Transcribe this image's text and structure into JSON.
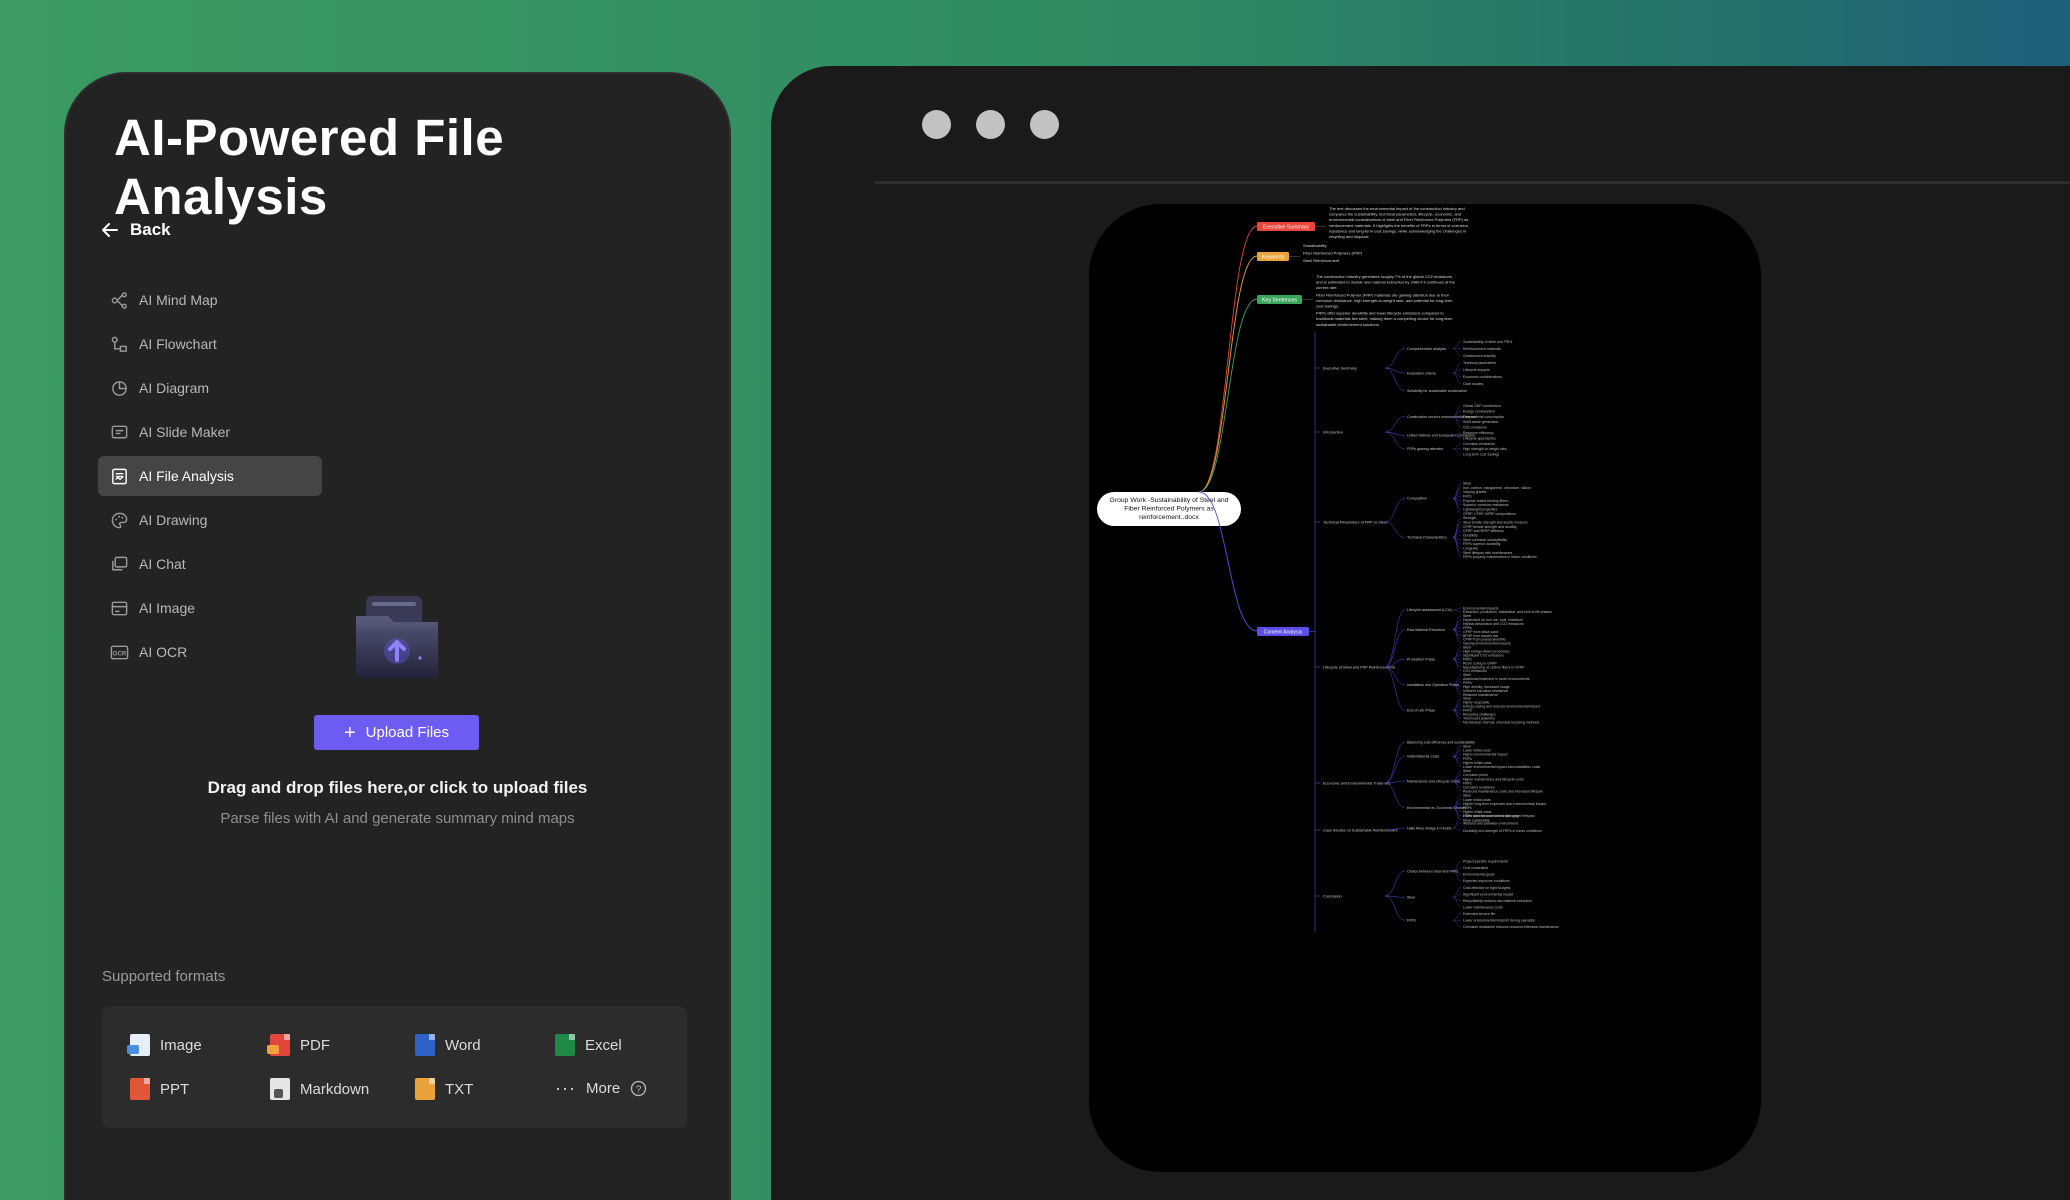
{
  "panel": {
    "title": "AI-Powered File Analysis",
    "back_label": "Back",
    "menu": [
      {
        "label": "AI Mind Map",
        "icon": "mind-map-icon",
        "active": false
      },
      {
        "label": "AI Flowchart",
        "icon": "flowchart-icon",
        "active": false
      },
      {
        "label": "AI Diagram",
        "icon": "diagram-icon",
        "active": false
      },
      {
        "label": "AI Slide Maker",
        "icon": "slide-icon",
        "active": false
      },
      {
        "label": "AI File Analysis",
        "icon": "file-analysis-icon",
        "active": true
      },
      {
        "label": "AI Drawing",
        "icon": "palette-icon",
        "active": false
      },
      {
        "label": "AI Chat",
        "icon": "chat-icon",
        "active": false
      },
      {
        "label": "AI Image",
        "icon": "image-icon",
        "active": false
      },
      {
        "label": "AI OCR",
        "icon": "ocr-icon",
        "active": false
      }
    ],
    "upload": {
      "button_label": "Upload Files",
      "drop_title": "Drag and drop files here,or click to upload files",
      "drop_subtitle": "Parse files with AI and generate summary mind maps"
    },
    "formats_label": "Supported formats",
    "formats": [
      {
        "label": "Image",
        "icon": "image-file-icon",
        "color": "#4a8fe0"
      },
      {
        "label": "PDF",
        "icon": "pdf-file-icon",
        "color": "#e2463a"
      },
      {
        "label": "Word",
        "icon": "word-file-icon",
        "color": "#2f62c8"
      },
      {
        "label": "Excel",
        "icon": "excel-file-icon",
        "color": "#1f8a47"
      },
      {
        "label": "PPT",
        "icon": "ppt-file-icon",
        "color": "#e2563a"
      },
      {
        "label": "Markdown",
        "icon": "markdown-file-icon",
        "color": "#e6e6e6"
      },
      {
        "label": "TXT",
        "icon": "txt-file-icon",
        "color": "#e9a33a"
      },
      {
        "label": "More",
        "icon": "more-icon",
        "color": "#dcdcdc"
      }
    ],
    "accent_color": "#6c5cf2"
  },
  "mindmap": {
    "root": "Group Work -Sustainability of Steel and Fiber Reinforced Polymers as reinforcement..docx",
    "root_lines": [
      "Group Work -Sustainability of Steel and",
      "Fiber Reinforced Polymers as",
      "reinforcement..docx"
    ],
    "branches": [
      {
        "label": "Executive Summary",
        "color": "#e8453c",
        "notes": [
          "The text discusses the environmental impact of the construction industry and",
          "compares the sustainability, technical parameters, lifecycle, economic, and",
          "environmental considerations of steel and Fiber Reinforced Polymers (FRP) as",
          "reinforcement materials. It highlights the benefits of FRPs in terms of corrosion",
          "resistance and long-term cost savings, while acknowledging the challenges in",
          "recycling and disposal."
        ]
      },
      {
        "label": "Keywords",
        "color": "#e8a33a",
        "notes": [
          "Sustainability",
          "Fiber Reinforced Polymers (FRP)",
          "Steel Reinforcement"
        ]
      },
      {
        "label": "Key Sentences",
        "color": "#3aa65a",
        "notes": [
          "The construction industry generates roughly 7% of the global CO2 emissions",
          "and is estimated to double raw material extraction by 2060 if it continues at the",
          "current rate.",
          "Fiber Reinforced Polymer (FRP) materials are gaining attention due to their",
          "corrosion resistance, high strength-to-weight ratio, and potential for long-term",
          "cost savings.",
          "FRPs offer superior durability and lower lifecycle emissions compared to",
          "traditional materials like steel, making them a compelling choice for long-term",
          "sustainable reinforcement solutions."
        ]
      },
      {
        "label": "Content Analysis",
        "color": "#5a4ee6",
        "notes": []
      }
    ],
    "content_sections": [
      {
        "label": "Executive Summary",
        "children": [
          {
            "label": "Comprehensive analysis",
            "leaves": [
              "Sustainability of steel and FRPs",
              "Reinforcement materials",
              "Construction industry"
            ]
          },
          {
            "label": "Evaluation criteria",
            "leaves": [
              "Technical parameters",
              "Lifecycle impacts",
              "Economic considerations",
              "Case studies"
            ]
          },
          {
            "label": "Suitability for sustainable construction",
            "leaves": []
          }
        ]
      },
      {
        "label": "Introduction",
        "children": [
          {
            "label": "Construction sector's environmental impact",
            "leaves": [
              "Global GDP contribution",
              "Energy consumption",
              "Raw material consumption",
              "Solid waste generation",
              "CO2 emissions"
            ]
          },
          {
            "label": "United Nations and European Commission",
            "leaves": [
              "Resource efficiency",
              "Lifecycle approaches"
            ]
          },
          {
            "label": "FRPs gaining attention",
            "leaves": [
              "Corrosion resistance",
              "High strength-to-weight ratio",
              "Long-term cost savings"
            ]
          }
        ]
      },
      {
        "label": "Technical Parameters of FRP vs Steel",
        "children": [
          {
            "label": "Composition",
            "leaves": [
              "Steel",
              "Iron, carbon, manganese, chromium, silicon",
              "Varying grades",
              "FRPs",
              "Polymer matrix binding fibers",
              "Superior corrosion resistance",
              "Lightweight properties",
              "GFRP, CFRP, BFRP compositions"
            ]
          },
          {
            "label": "Technical Characteristics",
            "leaves": [
              "Strength",
              "Steel tensile strength and elastic modulus",
              "CFRP tensile strength and ductility",
              "GFRP and BFRP stiffness",
              "Durability",
              "Steel corrosion susceptibility",
              "FRPs superior durability",
              "Longevity",
              "Steel lifespan with maintenance",
              "FRPs property maintenance in harsh conditions"
            ]
          }
        ]
      },
      {
        "label": "Lifecycle of Steel and FRP Reinforcements",
        "children": [
          {
            "label": "Lifecycle assessment (LCA)",
            "leaves": [
              "Environmental impacts",
              "Extraction, production, installation, and end-of-life phases"
            ]
          },
          {
            "label": "Raw Material Extraction",
            "leaves": [
              "Steel",
              "Dependent on iron ore, coal, limestone",
              "Habitat destruction and CO2 emissions",
              "FRPs",
              "GFRP from silica sand",
              "BFRP from basalt rock",
              "CFRP from polyacrylonitrile",
              "Varying environmental impacts"
            ]
          },
          {
            "label": "Production Phase",
            "leaves": [
              "Steel",
              "High energy-driven processes",
              "Significant CO2 emissions",
              "FRPs",
              "Resin curing in GFRP",
              "Manufacturing of carbon fibers in CFRP",
              "CO2 emissions"
            ]
          },
          {
            "label": "Installation and Operation Phase",
            "leaves": [
              "Steel",
              "Additional treatment in harsh environments",
              "FRPs",
              "High density, increased usage",
              "Inherent corrosion resistance",
              "Reduced maintenance"
            ]
          },
          {
            "label": "End of Life Phase",
            "leaves": [
              "Steel",
              "Highly recyclable",
              "Energy saving and reduced environmental impact",
              "FRPs",
              "Recycling challenges",
              "Thermoset polymers",
              "Mechanical, thermal, chemical recycling methods"
            ]
          }
        ]
      },
      {
        "label": "Economic and Environmental Trade-offs",
        "children": [
          {
            "label": "Balancing cost efficiency and sustainability",
            "leaves": []
          },
          {
            "label": "Initial Material Costs",
            "leaves": [
              "Steel",
              "Lower initial costs",
              "Higher environmental impact",
              "FRPs",
              "Higher initial costs",
              "Lower environmental impact and installation costs"
            ]
          },
          {
            "label": "Maintenance and Lifecycle Costs",
            "leaves": [
              "Steel",
              "Corrosion prone",
              "Higher maintenance and lifecycle costs",
              "FRPs",
              "Corrosion resistance",
              "Reduced maintenance costs and increased lifespan"
            ]
          },
          {
            "label": "Environmental vs. Economic Choices",
            "leaves": [
              "Steel",
              "Lower initial costs",
              "Higher long-term expenses and environmental impact",
              "FRPs",
              "Higher initial costs",
              "Lower maintenance needs and longer lifespan",
              "More sustainable"
            ]
          }
        ]
      },
      {
        "label": "Case Studies on Sustainable Reinforcement",
        "children": [
          {
            "label": "Halls River Bridge in Florida",
            "leaves": [
              "FRPs used for corrosion challenges",
              "Wetland and saltwater environment",
              "Durability and strength of FRPs in harsh conditions"
            ]
          }
        ]
      },
      {
        "label": "Conclusion",
        "children": [
          {
            "label": "Choice between steel and FRPs",
            "leaves": [
              "Project-specific requirements",
              "Cost constraints",
              "Environmental goals",
              "Expected exposure conditions"
            ]
          },
          {
            "label": "Steel",
            "leaves": [
              "Cost-effective for tight budgets",
              "Significant environmental impact",
              "Recyclability reduces raw material extraction",
              "Lower maintenance costs"
            ]
          },
          {
            "label": "FRPs",
            "leaves": [
              "Extended service life",
              "Lower environmental footprint during operation",
              "Corrosion resistance reduces resource-intensive maintenance"
            ]
          }
        ]
      }
    ]
  }
}
